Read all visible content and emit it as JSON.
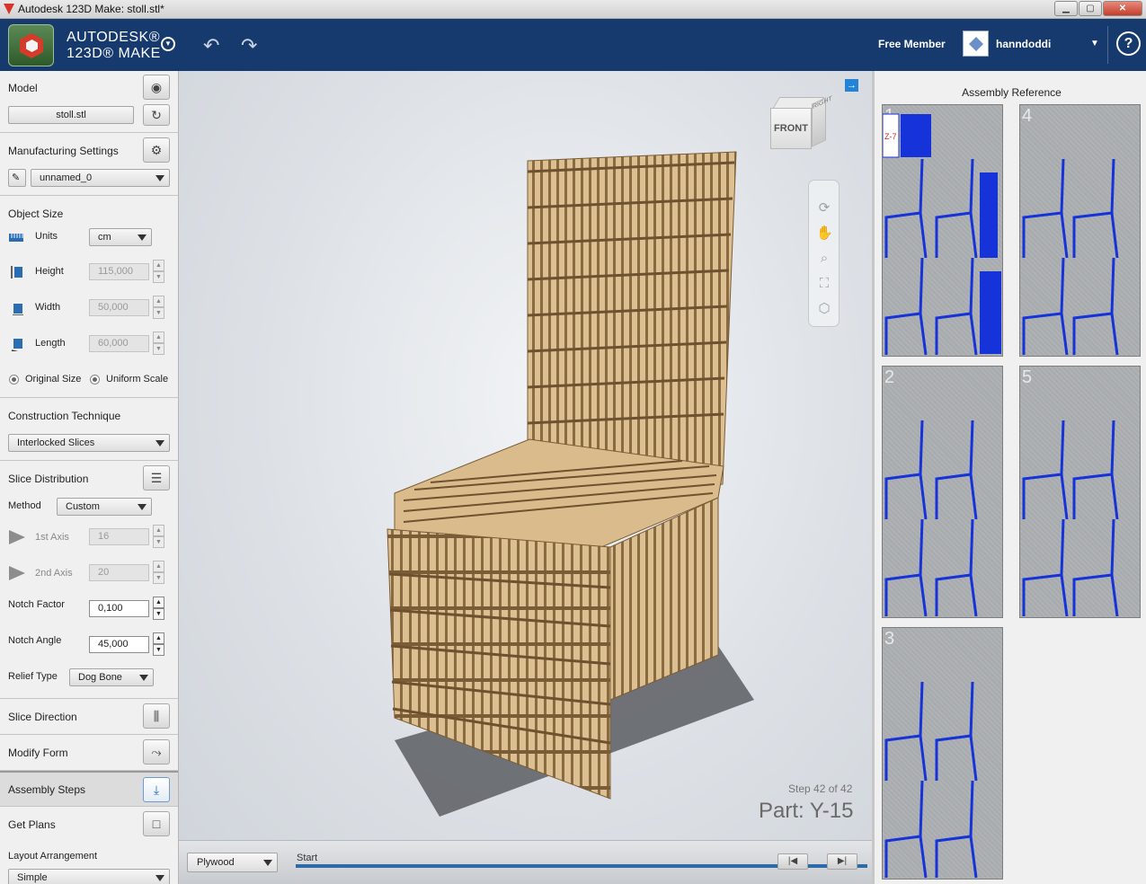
{
  "window": {
    "title": "Autodesk 123D Make: stoll.stl*",
    "min": "▁",
    "max": "▢",
    "close": "✕"
  },
  "header": {
    "brand_line1": "AUTODESK®",
    "brand_line2": "123D® MAKE",
    "member_label": "Free Member",
    "username": "hanndoddi",
    "help": "?"
  },
  "left": {
    "model": {
      "title": "Model",
      "file": "stoll.stl"
    },
    "manufacturing": {
      "title": "Manufacturing Settings",
      "preset": "unnamed_0"
    },
    "object_size": {
      "title": "Object Size",
      "units_label": "Units",
      "units_value": "cm",
      "height_label": "Height",
      "height_value": "115,000",
      "width_label": "Width",
      "width_value": "50,000",
      "length_label": "Length",
      "length_value": "60,000",
      "original_size": "Original Size",
      "uniform_scale": "Uniform Scale"
    },
    "construction": {
      "title": "Construction Technique",
      "value": "Interlocked Slices"
    },
    "slice_distribution": {
      "title": "Slice Distribution",
      "method_label": "Method",
      "method_value": "Custom",
      "axis1_label": "1st Axis",
      "axis1_value": "16",
      "axis2_label": "2nd Axis",
      "axis2_value": "20",
      "notch_factor_label": "Notch Factor",
      "notch_factor_value": "0,100",
      "notch_angle_label": "Notch Angle",
      "notch_angle_value": "45,000",
      "relief_label": "Relief Type",
      "relief_value": "Dog Bone"
    },
    "slice_direction": {
      "title": "Slice Direction"
    },
    "modify_form": {
      "title": "Modify Form"
    },
    "assembly_steps": {
      "title": "Assembly Steps"
    },
    "get_plans": {
      "title": "Get Plans",
      "layout_label": "Layout Arrangement",
      "layout_value": "Simple"
    }
  },
  "viewport": {
    "viewcube_front": "FRONT",
    "viewcube_right": "RIGHT",
    "step_text": "Step 42 of 42",
    "part_text": "Part: Y-15",
    "material": "Plywood",
    "slider_label": "Start"
  },
  "assembly": {
    "title": "Assembly Reference",
    "sheets": [
      "1",
      "4",
      "2",
      "5",
      "3"
    ],
    "sheet1_tag": "Z-7"
  }
}
